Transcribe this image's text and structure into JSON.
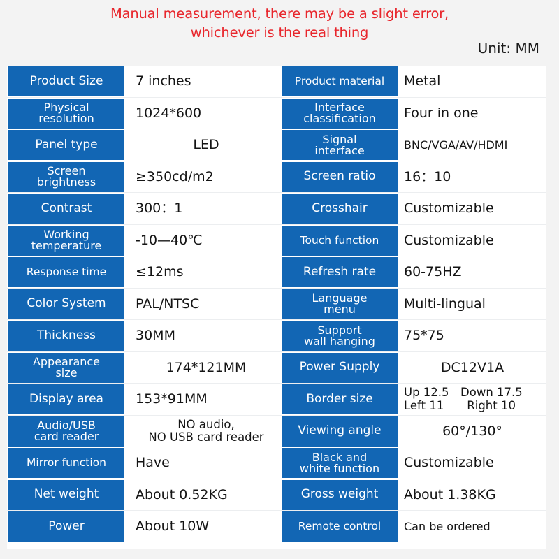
{
  "header": {
    "note_line1": "Manual measurement, there may be a slight error,",
    "note_line2": "whichever is the real thing",
    "note_color": "#e8262c",
    "unit": "Unit: MM"
  },
  "theme": {
    "label_bg": "#1266b4",
    "label_text": "#ffffff",
    "value_text": "#141414",
    "table_bg": "#ffffff",
    "page_bg": "#f3f3f3",
    "row_divider": "#eceef0"
  },
  "spec_table": {
    "rows": [
      {
        "left_label": "Product Size",
        "left_value": "7 inches",
        "right_label": "Product material",
        "right_value": "Metal"
      },
      {
        "left_label_line1": "Physical",
        "left_label_line2": "resolution",
        "left_value": "1024*600",
        "right_label_line1": "Interface",
        "right_label_line2": "classification",
        "right_value": "Four in one"
      },
      {
        "left_label": "Panel type",
        "left_value": "LED",
        "right_label_line1": "Signal",
        "right_label_line2": "interface",
        "right_value": "BNC/VGA/AV/HDMI"
      },
      {
        "left_label_line1": "Screen",
        "left_label_line2": "brightness",
        "left_value": "≥350cd/m2",
        "right_label": "Screen ratio",
        "right_value": "16：10"
      },
      {
        "left_label": "Contrast",
        "left_value": "300：1",
        "right_label": "Crosshair",
        "right_value": "Customizable"
      },
      {
        "left_label_line1": "Working",
        "left_label_line2": "temperature",
        "left_value": "-10—40℃",
        "right_label": "Touch function",
        "right_value": "Customizable"
      },
      {
        "left_label": "Response time",
        "left_value": "≤12ms",
        "right_label": "Refresh rate",
        "right_value": "60-75HZ"
      },
      {
        "left_label": "Color System",
        "left_value": "PAL/NTSC",
        "right_label_line1": "Language",
        "right_label_line2": "menu",
        "right_value": "Multi-lingual"
      },
      {
        "left_label": "Thickness",
        "left_value": "30MM",
        "right_label_line1": "Support",
        "right_label_line2": "wall hanging",
        "right_value": "75*75"
      },
      {
        "left_label_line1": "Appearance",
        "left_label_line2": "size",
        "left_value": "174*121MM",
        "right_label": "Power Supply",
        "right_value": "DC12V1A"
      },
      {
        "left_label": "Display area",
        "left_value": "153*91MM",
        "right_label": "Border size",
        "right_value_line1": "Up 12.5 Down 17.5",
        "right_value_line2": "Left 11  Right 10"
      },
      {
        "left_label_line1": "Audio/USB",
        "left_label_line2": "card reader",
        "left_value_line1": "NO audio,",
        "left_value_line2": "NO USB card reader",
        "right_label": "Viewing angle",
        "right_value": "60°/130°"
      },
      {
        "left_label": "Mirror function",
        "left_value": "Have",
        "right_label_line1": "Black and",
        "right_label_line2": "white function",
        "right_value": "Customizable"
      },
      {
        "left_label": "Net weight",
        "left_value": "About 0.52KG",
        "right_label": "Gross weight",
        "right_value": "About 1.38KG"
      },
      {
        "left_label": "Power",
        "left_value": "About 10W",
        "right_label": "Remote control",
        "right_value": "Can be ordered"
      }
    ]
  }
}
